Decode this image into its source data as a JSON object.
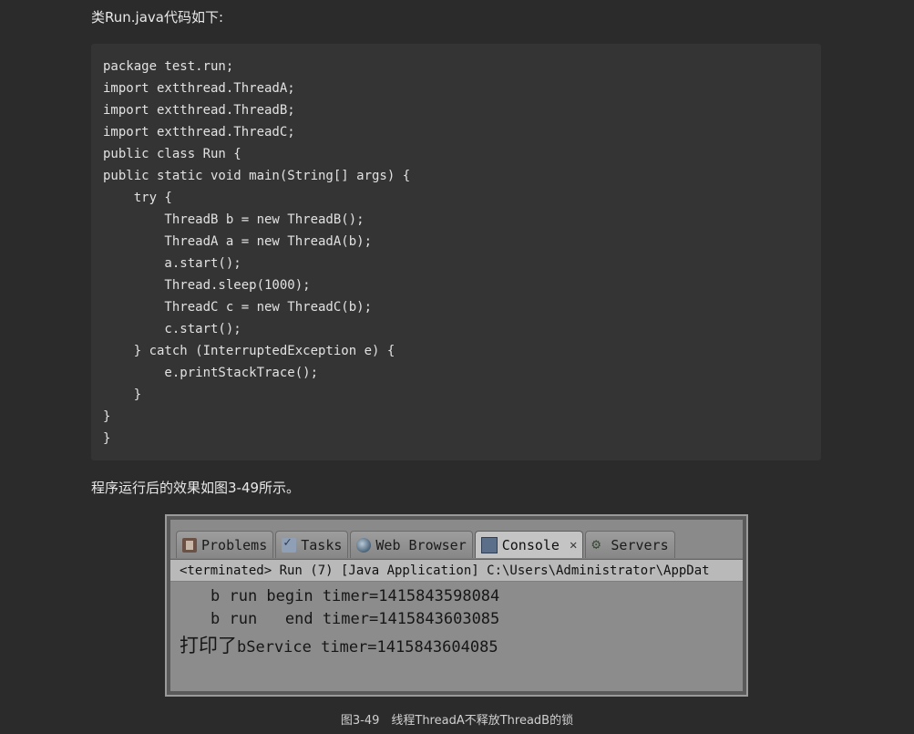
{
  "intro_text": "类Run.java代码如下:",
  "code_lines": [
    "package test.run;",
    "import extthread.ThreadA;",
    "import extthread.ThreadB;",
    "import extthread.ThreadC;",
    "public class Run {",
    "public static void main(String[] args) {",
    "    try {",
    "        ThreadB b = new ThreadB();",
    "        ThreadA a = new ThreadA(b);",
    "        a.start();",
    "        Thread.sleep(1000);",
    "        ThreadC c = new ThreadC(b);",
    "        c.start();",
    "    } catch (InterruptedException e) {",
    "        e.printStackTrace();",
    "    }",
    "}",
    "}"
  ],
  "result_text": "程序运行后的效果如图3-49所示。",
  "screenshot": {
    "tabs": [
      {
        "label": "Problems",
        "icon": "problems-icon"
      },
      {
        "label": "Tasks",
        "icon": "tasks-icon"
      },
      {
        "label": "Web Browser",
        "icon": "web-browser-icon"
      },
      {
        "label": "Console",
        "icon": "console-icon",
        "active": true
      },
      {
        "label": "Servers",
        "icon": "servers-icon"
      }
    ],
    "console_header": "<terminated> Run (7) [Java Application] C:\\Users\\Administrator\\AppDat",
    "output_lines": [
      "b run begin timer=1415843598084",
      "b run   end timer=1415843603085"
    ],
    "output_line3_prefix": "打印了",
    "output_line3_rest": "bService timer=1415843604085"
  },
  "caption": "图3-49　线程ThreadA不释放ThreadB的锁"
}
